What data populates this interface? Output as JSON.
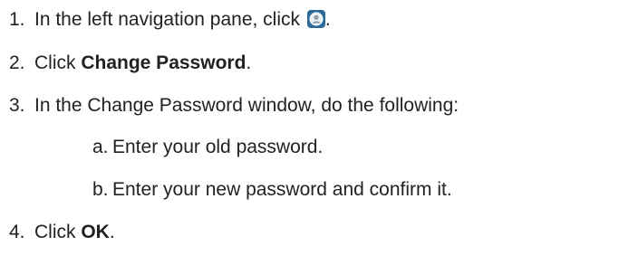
{
  "steps": [
    {
      "number": "1.",
      "text_before": "In the left navigation pane, click ",
      "icon": "user-profile-icon",
      "text_after": "."
    },
    {
      "number": "2.",
      "text_before": "Click ",
      "bold": "Change Password",
      "text_after": "."
    },
    {
      "number": "3.",
      "text": "In the Change Password window, do the following:",
      "substeps": [
        {
          "letter": "a.",
          "text": "Enter your old password."
        },
        {
          "letter": "b.",
          "text": "Enter your new password and confirm it."
        }
      ]
    },
    {
      "number": "4.",
      "text_before": "Click ",
      "bold": "OK",
      "text_after": "."
    }
  ],
  "colors": {
    "text": "#222222",
    "icon_bg": "#2a6a9a"
  }
}
